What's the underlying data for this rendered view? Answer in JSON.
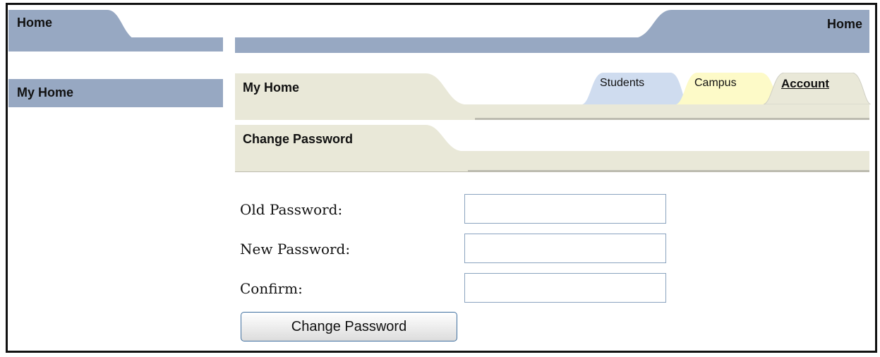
{
  "left": {
    "home_tab": "Home",
    "my_home": "My Home"
  },
  "top": {
    "home_tab": "Home"
  },
  "section": {
    "title": "My Home",
    "tabs": [
      {
        "label": "Students"
      },
      {
        "label": "Campus"
      },
      {
        "label": "Account"
      }
    ]
  },
  "subsection": {
    "title": "Change Password"
  },
  "form": {
    "old_label": "Old Password:",
    "new_label": "New Password:",
    "confirm_label": "Confirm:",
    "old_value": "",
    "new_value": "",
    "confirm_value": "",
    "submit_label": "Change Password"
  },
  "colors": {
    "nav_blue": "#97a8c2",
    "section_beige": "#e9e8d8",
    "students_tab": "#cfdcef",
    "campus_tab": "#fdfac8",
    "account_tab": "#e9e8d8"
  }
}
